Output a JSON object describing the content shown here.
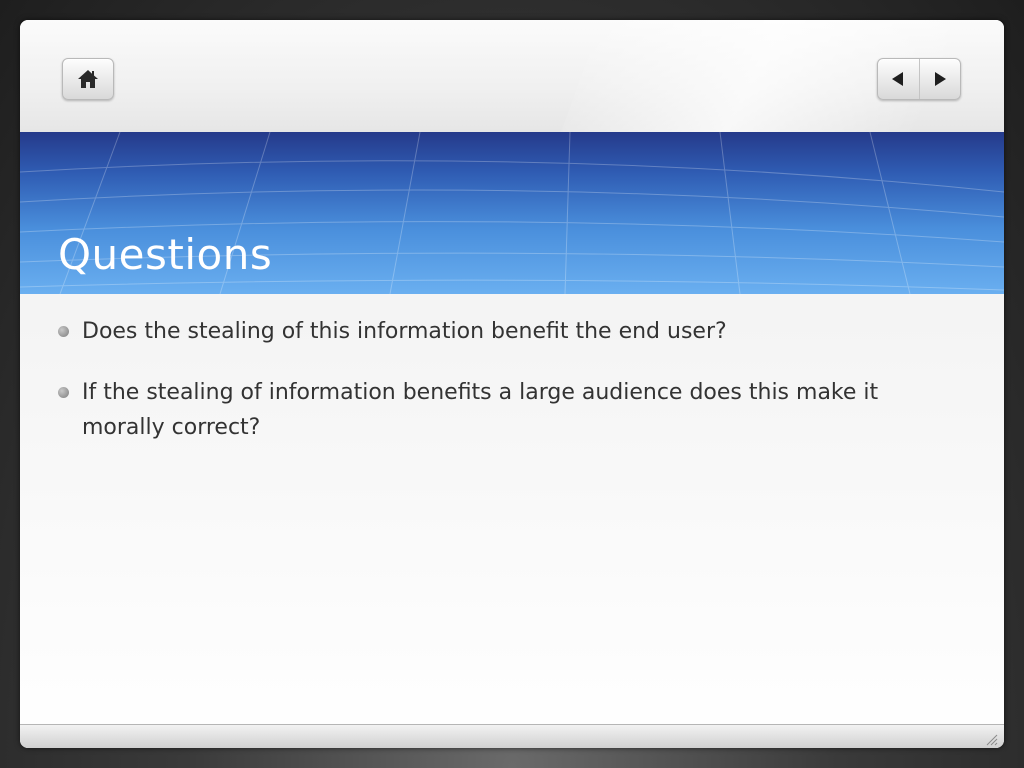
{
  "slide": {
    "title": "Questions",
    "bullets": [
      "Does the stealing of this information benefit the end user?",
      "If the stealing of information benefits a large audience does this make it morally correct?"
    ]
  },
  "controls": {
    "home_icon": "home-icon",
    "prev_icon": "triangle-left-icon",
    "next_icon": "triangle-right-icon",
    "resize_icon": "resize-grip-icon"
  },
  "colors": {
    "title_band_top": "#253a8a",
    "title_band_bottom": "#6aaff0",
    "title_text": "#ffffff",
    "body_text": "#333333"
  }
}
